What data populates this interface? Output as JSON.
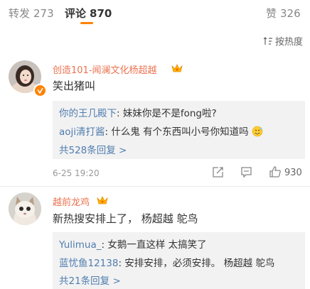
{
  "tabs": {
    "repost": {
      "label": "转发",
      "count": "273"
    },
    "comment": {
      "label": "评论",
      "count": "870"
    },
    "like": {
      "label": "赞",
      "count": "326"
    }
  },
  "sort": {
    "label": "按热度"
  },
  "comments": [
    {
      "user": "创造101-闻澜文化杨超越",
      "text": "笑出猪叫",
      "replies": [
        {
          "user": "你的王几殿下",
          "text": ": 妹妹你是不是fong啦?"
        },
        {
          "user": "aoji清打酱",
          "text": ": 什么鬼  有个东西叫小号你知道吗"
        }
      ],
      "more": "共528条回复 >",
      "time": "6-25 19:20",
      "likes": "930"
    },
    {
      "user": "越前龙鸡",
      "text": "新热搜安排上了，  杨超越 鸵鸟",
      "replies": [
        {
          "user": "Yulimua_",
          "text": ": 女鹅一直这样 太搞笑了"
        },
        {
          "user": "蓝忧鱼12138",
          "text": ": 安排安排，必须安排。  杨超越 鸵鸟"
        }
      ],
      "more": "共21条回复 >"
    }
  ],
  "colors": {
    "accent": "#ff8200",
    "link": "#507daf",
    "name_orange": "#eb7350"
  }
}
